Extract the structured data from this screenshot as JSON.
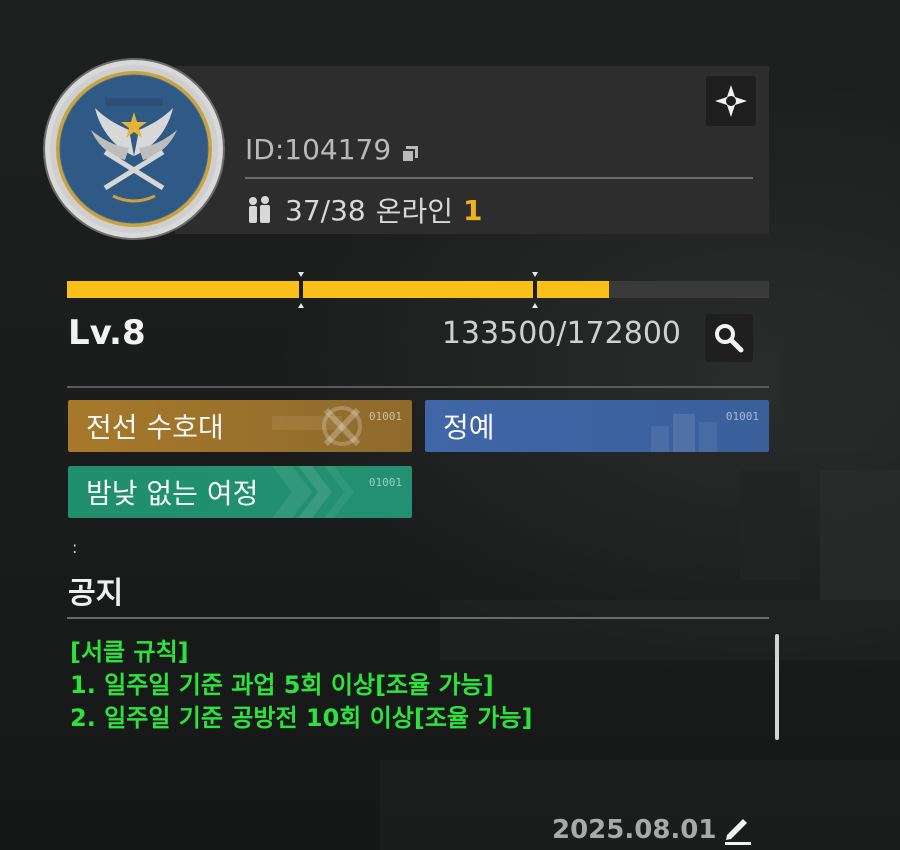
{
  "header": {
    "id_label": "ID:104179",
    "members": "37/38",
    "online_label": "온라인",
    "online_count": "1",
    "settings_icon": "settings-diamond-icon",
    "copy_icon": "copy-icon",
    "members_icon": "members-icon"
  },
  "emblem": {
    "icon": "guild-emblem-winged-star",
    "colors": {
      "ring": "#d9d9d9",
      "gold": "#d9a93a",
      "blue": "#2f5a86"
    }
  },
  "level": {
    "label": "Lv.8",
    "xp_text": "133500/172800",
    "progress": 0.7726,
    "segment_markers": [
      0.333,
      0.667
    ],
    "bar_color": "#fbbf19",
    "search_icon": "search-icon"
  },
  "tags": [
    {
      "label": "전선 수호대",
      "code": "01001",
      "color": "#a7792a"
    },
    {
      "label": "정예",
      "code": "01001",
      "color": "#3f66a6"
    },
    {
      "label": "밤낮 없는 여정",
      "code": "01001",
      "color": "#1f8f6c"
    }
  ],
  "misc": {
    "dot": ":"
  },
  "notice": {
    "title": "공지",
    "lines": [
      "[서클 규칙]",
      "1. 일주일 기준 과업 5회 이상[조율 가능]",
      "2. 일주일 기준 공방전 10회 이상[조율 가능]"
    ],
    "text_color": "#2ee23c",
    "date": "2025.08.01",
    "edit_icon": "edit-pencil-icon"
  }
}
